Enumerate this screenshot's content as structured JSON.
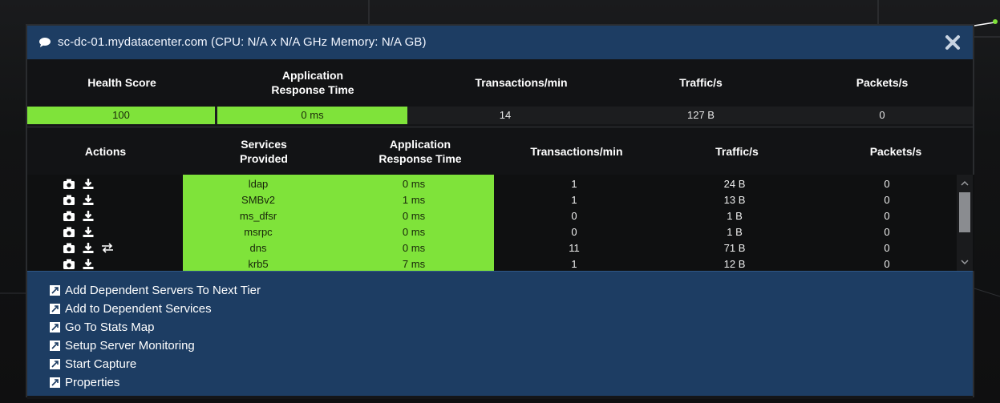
{
  "window": {
    "title": "sc-dc-01.mydatacenter.com (CPU: N/A x N/A GHz Memory: N/A GB)",
    "close_icon": "close-icon"
  },
  "summary": {
    "headers": [
      "Health Score",
      "Application\nResponse Time",
      "Transactions/min",
      "Traffic/s",
      "Packets/s"
    ],
    "values": {
      "health_score": "100",
      "response_time": "0 ms",
      "transactions": "14",
      "traffic": "127 B",
      "packets": "0"
    }
  },
  "services": {
    "headers": [
      "Actions",
      "Services\nProvided",
      "Application\nResponse Time",
      "Transactions/min",
      "Traffic/s",
      "Packets/s"
    ],
    "rows": [
      {
        "service": "ldap",
        "response": "0 ms",
        "transactions": "1",
        "traffic": "24 B",
        "packets": "0",
        "actions": [
          "camera-icon",
          "download-icon"
        ]
      },
      {
        "service": "SMBv2",
        "response": "1 ms",
        "transactions": "1",
        "traffic": "13 B",
        "packets": "0",
        "actions": [
          "camera-icon",
          "download-icon"
        ]
      },
      {
        "service": "ms_dfsr",
        "response": "0 ms",
        "transactions": "0",
        "traffic": "1 B",
        "packets": "0",
        "actions": [
          "camera-icon",
          "download-icon"
        ]
      },
      {
        "service": "msrpc",
        "response": "0 ms",
        "transactions": "0",
        "traffic": "1 B",
        "packets": "0",
        "actions": [
          "camera-icon",
          "download-icon"
        ]
      },
      {
        "service": "dns",
        "response": "0 ms",
        "transactions": "11",
        "traffic": "71 B",
        "packets": "0",
        "actions": [
          "camera-icon",
          "download-icon",
          "swap-arrows-icon"
        ]
      },
      {
        "service": "krb5",
        "response": "7 ms",
        "transactions": "1",
        "traffic": "12 B",
        "packets": "0",
        "actions": [
          "camera-icon",
          "download-icon"
        ]
      }
    ]
  },
  "menu": {
    "items": [
      "Add Dependent Servers To Next Tier",
      "Add to Dependent Services",
      "Go To Stats Map",
      "Setup Server Monitoring",
      "Start Capture",
      "Properties"
    ]
  },
  "colors": {
    "title_bar": "#1d3d63",
    "health_green": "#7fe33a",
    "panel_bg": "#141517"
  }
}
